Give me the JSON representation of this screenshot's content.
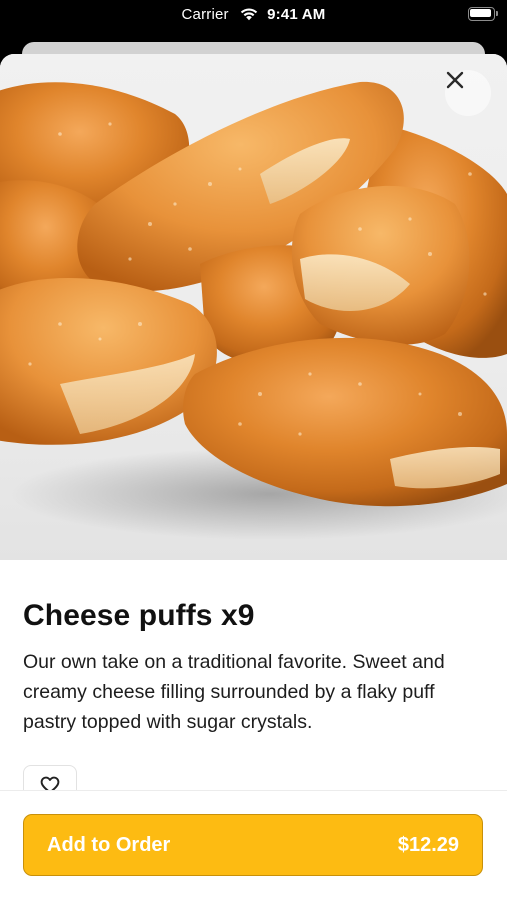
{
  "status_bar": {
    "carrier": "Carrier",
    "time": "9:41 AM",
    "icons": [
      "wifi-icon",
      "battery-icon"
    ]
  },
  "item": {
    "name": "Cheese puffs x9",
    "description": "Our own take on a traditional favorite.  Sweet and creamy cheese filling surrounded by a flaky puff pastry topped with sugar crystals.",
    "image_alt": "Golden cheese puff pastries"
  },
  "controls": {
    "close_icon": "close-icon",
    "favorite_icon": "heart-icon"
  },
  "cta": {
    "label": "Add to Order",
    "price": "$12.29"
  },
  "colors": {
    "accent": "#fdbb12",
    "accent_border": "#c8900a",
    "background": "#ffffff",
    "text": "#111111"
  }
}
